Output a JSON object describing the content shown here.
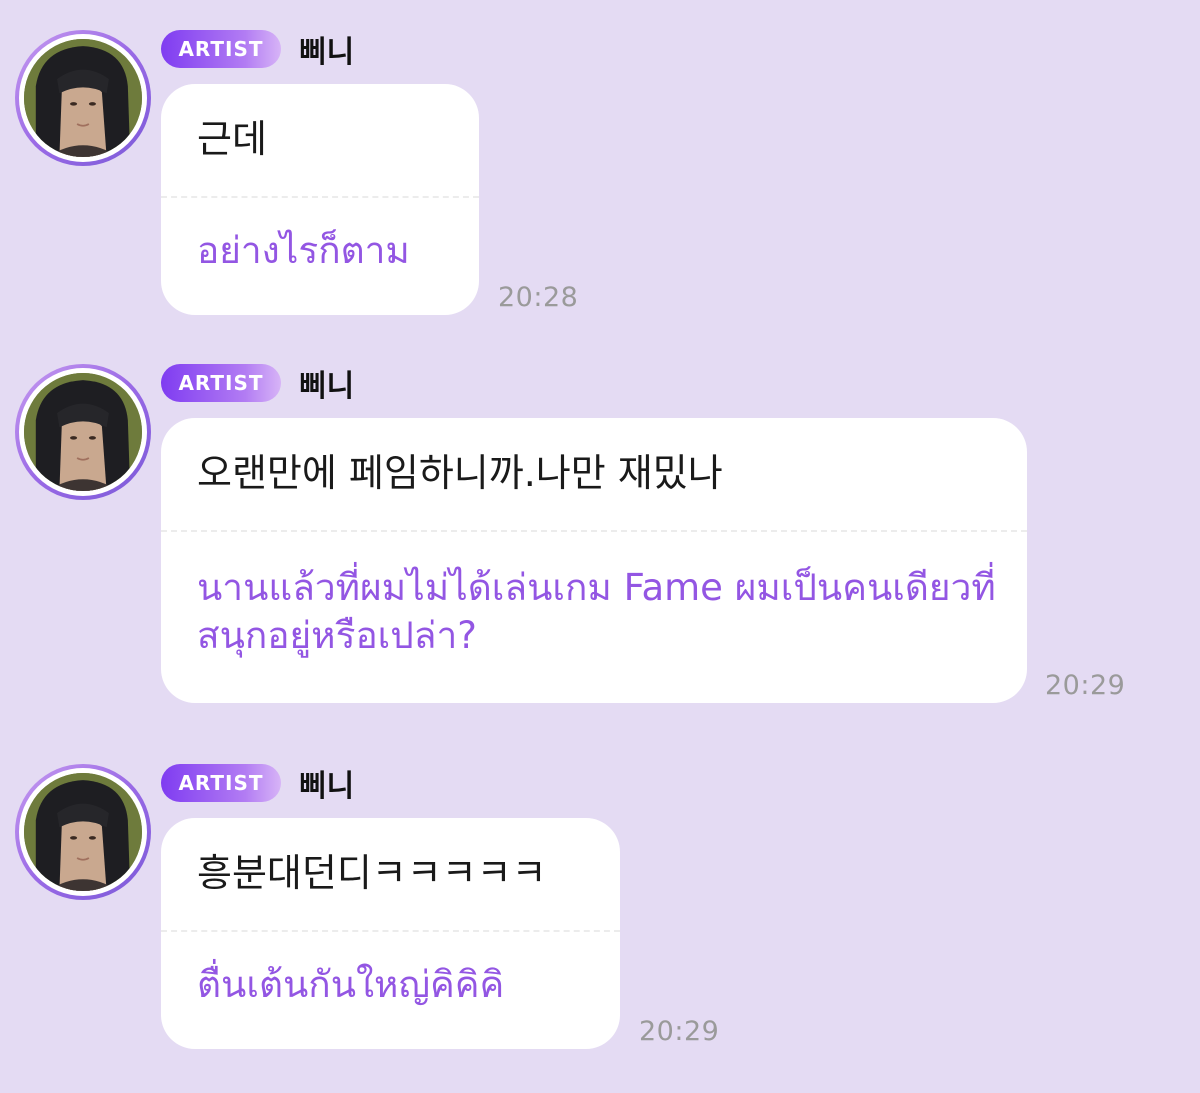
{
  "messages": [
    {
      "badge": "ARTIST",
      "sender": "삐니",
      "original": "근데",
      "translation": "อย่างไรก็ตาม",
      "time": "20:28"
    },
    {
      "badge": "ARTIST",
      "sender": "삐니",
      "original": "오랜만에 페임하니까.나만 재밌나",
      "translation": "นานแล้วที่ผมไม่ได้เล่นเกม Fame ผมเป็นคนเดียวที่สนุกอยู่หรือเปล่า?",
      "time": "20:29"
    },
    {
      "badge": "ARTIST",
      "sender": "삐니",
      "original": "흥분대던디ㅋㅋㅋㅋㅋ",
      "translation": "ตื่นเต้นกันใหญ่คิคิคิ",
      "time": "20:29"
    }
  ],
  "colors": {
    "background": "#e4dbf3",
    "translation_text": "#9356e3",
    "badge_start": "#7f3cf1",
    "badge_end": "#d7b4f7",
    "timestamp": "#9a9a9a"
  },
  "icons": {
    "avatar": "artist-avatar-photo"
  }
}
